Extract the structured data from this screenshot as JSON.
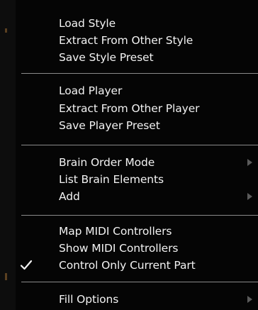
{
  "menu": {
    "groups": [
      {
        "items": [
          {
            "label": "Load Style"
          },
          {
            "label": "Extract From Other Style"
          },
          {
            "label": "Save Style Preset"
          }
        ]
      },
      {
        "items": [
          {
            "label": "Load Player"
          },
          {
            "label": "Extract From Other Player"
          },
          {
            "label": "Save Player Preset"
          }
        ]
      },
      {
        "items": [
          {
            "label": "Brain Order Mode",
            "submenu": true
          },
          {
            "label": "List Brain Elements"
          },
          {
            "label": "Add",
            "submenu": true
          }
        ]
      },
      {
        "items": [
          {
            "label": "Map MIDI Controllers"
          },
          {
            "label": "Show MIDI Controllers"
          },
          {
            "label": "Control Only Current Part",
            "checked": true
          }
        ]
      },
      {
        "items": [
          {
            "label": "Fill Options",
            "submenu": true
          }
        ]
      }
    ]
  },
  "icons": {
    "submenu": "chevron-right-icon",
    "check": "check-icon"
  },
  "colors": {
    "background": "#050505",
    "text": "#f2f2f2",
    "separator": "#8a8a8a",
    "submenu_arrow": "#5b5b5b"
  }
}
